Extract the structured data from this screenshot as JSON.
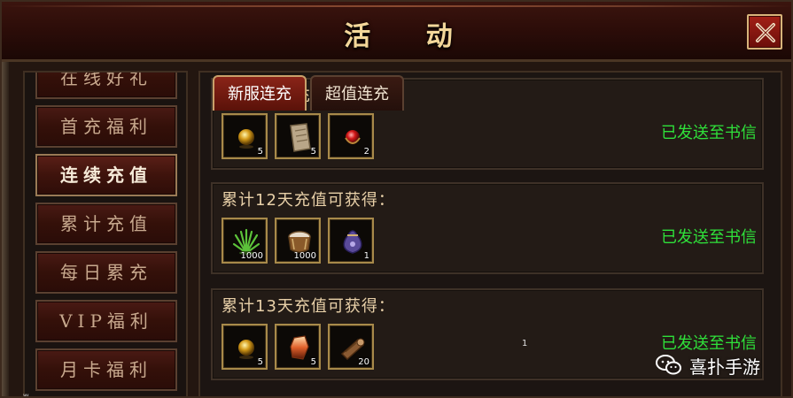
{
  "window": {
    "title": "活  动"
  },
  "sidebar": {
    "items": [
      {
        "label": "在线好礼"
      },
      {
        "label": "首充福利"
      },
      {
        "label": "连续充值",
        "active": true
      },
      {
        "label": "累计充值"
      },
      {
        "label": "每日累充"
      },
      {
        "label": "VIP福利"
      },
      {
        "label": "月卡福利"
      }
    ]
  },
  "tabs": [
    {
      "label": "新服连充",
      "active": true
    },
    {
      "label": "超值连充"
    }
  ],
  "rewards": [
    {
      "title": "累计11天充值可获得：",
      "status": "已发送至书信",
      "items": [
        {
          "icon": "gold-orb-icon",
          "count": "5"
        },
        {
          "icon": "scroll-icon",
          "count": "5"
        },
        {
          "icon": "red-gem-icon",
          "count": "2"
        }
      ]
    },
    {
      "title": "累计12天充值可获得：",
      "status": "已发送至书信",
      "items": [
        {
          "icon": "herb-icon",
          "count": "1000"
        },
        {
          "icon": "drum-icon",
          "count": "1000"
        },
        {
          "icon": "pouch-icon",
          "count": "1"
        }
      ]
    },
    {
      "title": "累计13天充值可获得：",
      "status": "已发送至书信",
      "items": [
        {
          "icon": "gold-orb-icon",
          "count": "5"
        },
        {
          "icon": "crystal-icon",
          "count": "5"
        },
        {
          "icon": "wood-log-icon",
          "count": "20"
        }
      ]
    }
  ],
  "watermark": {
    "text": "喜扑手游"
  },
  "stray_labels": {
    "center": "1",
    "corner": "w"
  },
  "colors": {
    "status_green": "#2fe03a",
    "title_gold": "#f3d79a",
    "active_tab": "#8a2418"
  }
}
